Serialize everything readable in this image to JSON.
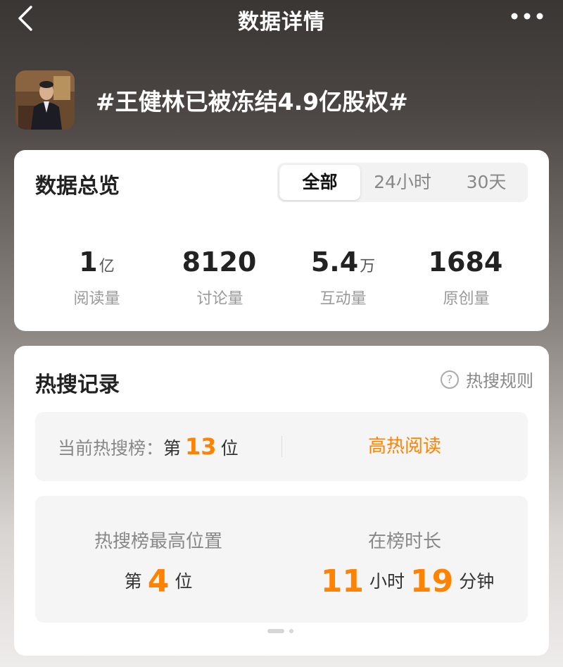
{
  "header": {
    "title": "数据详情"
  },
  "topic": {
    "title": "#王健林已被冻结4.9亿股权#"
  },
  "overview": {
    "title": "数据总览",
    "tabs": [
      {
        "label": "全部",
        "active": true
      },
      {
        "label": "24小时",
        "active": false
      },
      {
        "label": "30天",
        "active": false
      }
    ],
    "stats": [
      {
        "value": "1",
        "unit": "亿",
        "label": "阅读量"
      },
      {
        "value": "8120",
        "unit": "",
        "label": "讨论量"
      },
      {
        "value": "5.4",
        "unit": "万",
        "label": "互动量"
      },
      {
        "value": "1684",
        "unit": "",
        "label": "原创量"
      }
    ]
  },
  "hot_search": {
    "title": "热搜记录",
    "rules_label": "热搜规则",
    "current": {
      "label": "当前热搜榜：",
      "prefix": "第",
      "rank": "13",
      "suffix": "位"
    },
    "hot_read_label": "高热阅读",
    "peak": {
      "label": "热搜榜最高位置",
      "prefix": "第",
      "rank": "4",
      "suffix": "位"
    },
    "duration": {
      "label": "在榜时长",
      "hours": "11",
      "hours_unit": "小时",
      "minutes": "19",
      "minutes_unit": "分钟"
    }
  },
  "colors": {
    "accent": "#ff8200",
    "card_bg": "#ffffff",
    "box_bg": "#f5f5f5"
  }
}
